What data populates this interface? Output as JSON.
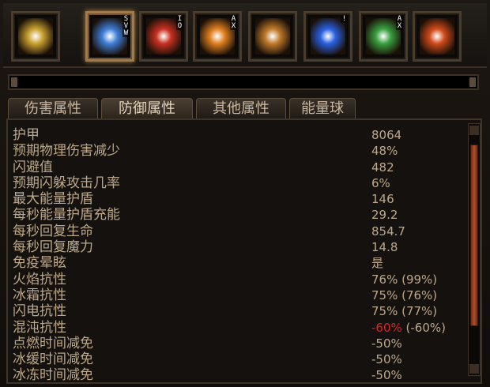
{
  "skills": [
    {
      "name": "sword-skill-icon",
      "keys": "",
      "selected": false,
      "color": "#c9a030"
    },
    {
      "name": "ice-burst-skill-icon",
      "keys": "SVW",
      "selected": true,
      "color": "#3f7fd8"
    },
    {
      "name": "fire-attack-skill-icon",
      "keys": "IO",
      "selected": false,
      "color": "#c83020"
    },
    {
      "name": "leap-strike-skill-icon",
      "keys": "AX",
      "selected": false,
      "color": "#e08020"
    },
    {
      "name": "swirl-skill-icon",
      "keys": "",
      "selected": false,
      "color": "#c07a2a"
    },
    {
      "name": "portal-skill-icon",
      "keys": "!",
      "selected": false,
      "color": "#2a60e0"
    },
    {
      "name": "poison-skill-icon",
      "keys": "AX",
      "selected": false,
      "color": "#3aa040"
    },
    {
      "name": "flame-shield-skill-icon",
      "keys": "",
      "selected": false,
      "color": "#d04a1a"
    }
  ],
  "tabs": [
    {
      "label": "伤害属性",
      "active": false
    },
    {
      "label": "防御属性",
      "active": true
    },
    {
      "label": "其他属性",
      "active": false
    },
    {
      "label": "能量球",
      "active": false
    }
  ],
  "stats": [
    {
      "label": "护甲",
      "value": "8064"
    },
    {
      "label": "预期物理伤害减少",
      "value": "48%"
    },
    {
      "label": "闪避值",
      "value": "482"
    },
    {
      "label": "预期闪躲攻击几率",
      "value": "6%"
    },
    {
      "label": "最大能量护盾",
      "value": "146"
    },
    {
      "label": "每秒能量护盾充能",
      "value": "29.2"
    },
    {
      "label": "每秒回复生命",
      "value": "854.7"
    },
    {
      "label": "每秒回复魔力",
      "value": "14.8"
    },
    {
      "label": "免疫晕眩",
      "value": "是"
    },
    {
      "label": "火焰抗性",
      "value": "76% (99%)"
    },
    {
      "label": "冰霜抗性",
      "value": "75% (76%)"
    },
    {
      "label": "闪电抗性",
      "value": "75% (77%)"
    },
    {
      "label": "混沌抗性",
      "value": "-60%",
      "extra": " (-60%)",
      "negative": true
    },
    {
      "label": "点燃时间减免",
      "value": "-50%"
    },
    {
      "label": "冰缓时间减免",
      "value": "-50%"
    },
    {
      "label": "冰冻时间减免",
      "value": "-50%"
    }
  ]
}
